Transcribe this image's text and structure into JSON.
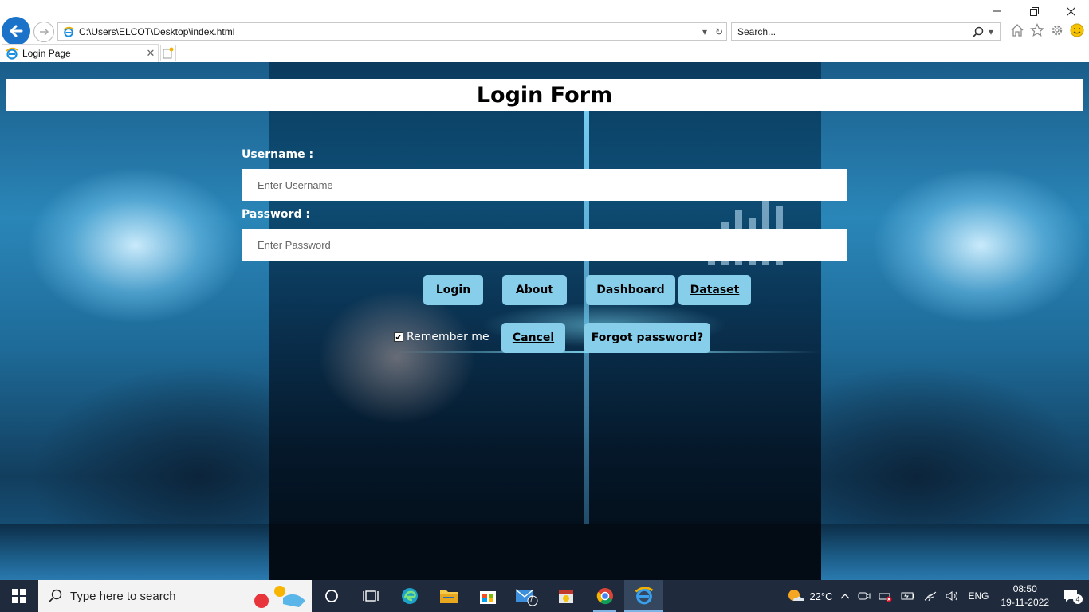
{
  "browser": {
    "address_url": "C:\\Users\\ELCOT\\Desktop\\index.html",
    "search_placeholder": "Search...",
    "tab_title": "Login Page"
  },
  "page": {
    "title": "Login Form",
    "username_label": "Username :",
    "username_placeholder": "Enter Username",
    "password_label": "Password :",
    "password_placeholder": "Enter Password",
    "buttons_row1": {
      "login": "Login",
      "about": "About",
      "dashboard": "Dashboard",
      "dataset": "Dataset"
    },
    "remember_label": "Remember me",
    "remember_checked": true,
    "buttons_row2": {
      "cancel": "Cancel",
      "forgot": "Forgot password?"
    }
  },
  "taskbar": {
    "search_placeholder": "Type here to search",
    "mail_badge": "7",
    "weather_temp": "22°C",
    "language": "ENG",
    "time": "08:50",
    "date": "19-11-2022",
    "notification_count": "4"
  },
  "colors": {
    "button_bg": "#87ceeb",
    "browser_back": "#1a73c8",
    "taskbar_bg": "#1f2b3c"
  }
}
